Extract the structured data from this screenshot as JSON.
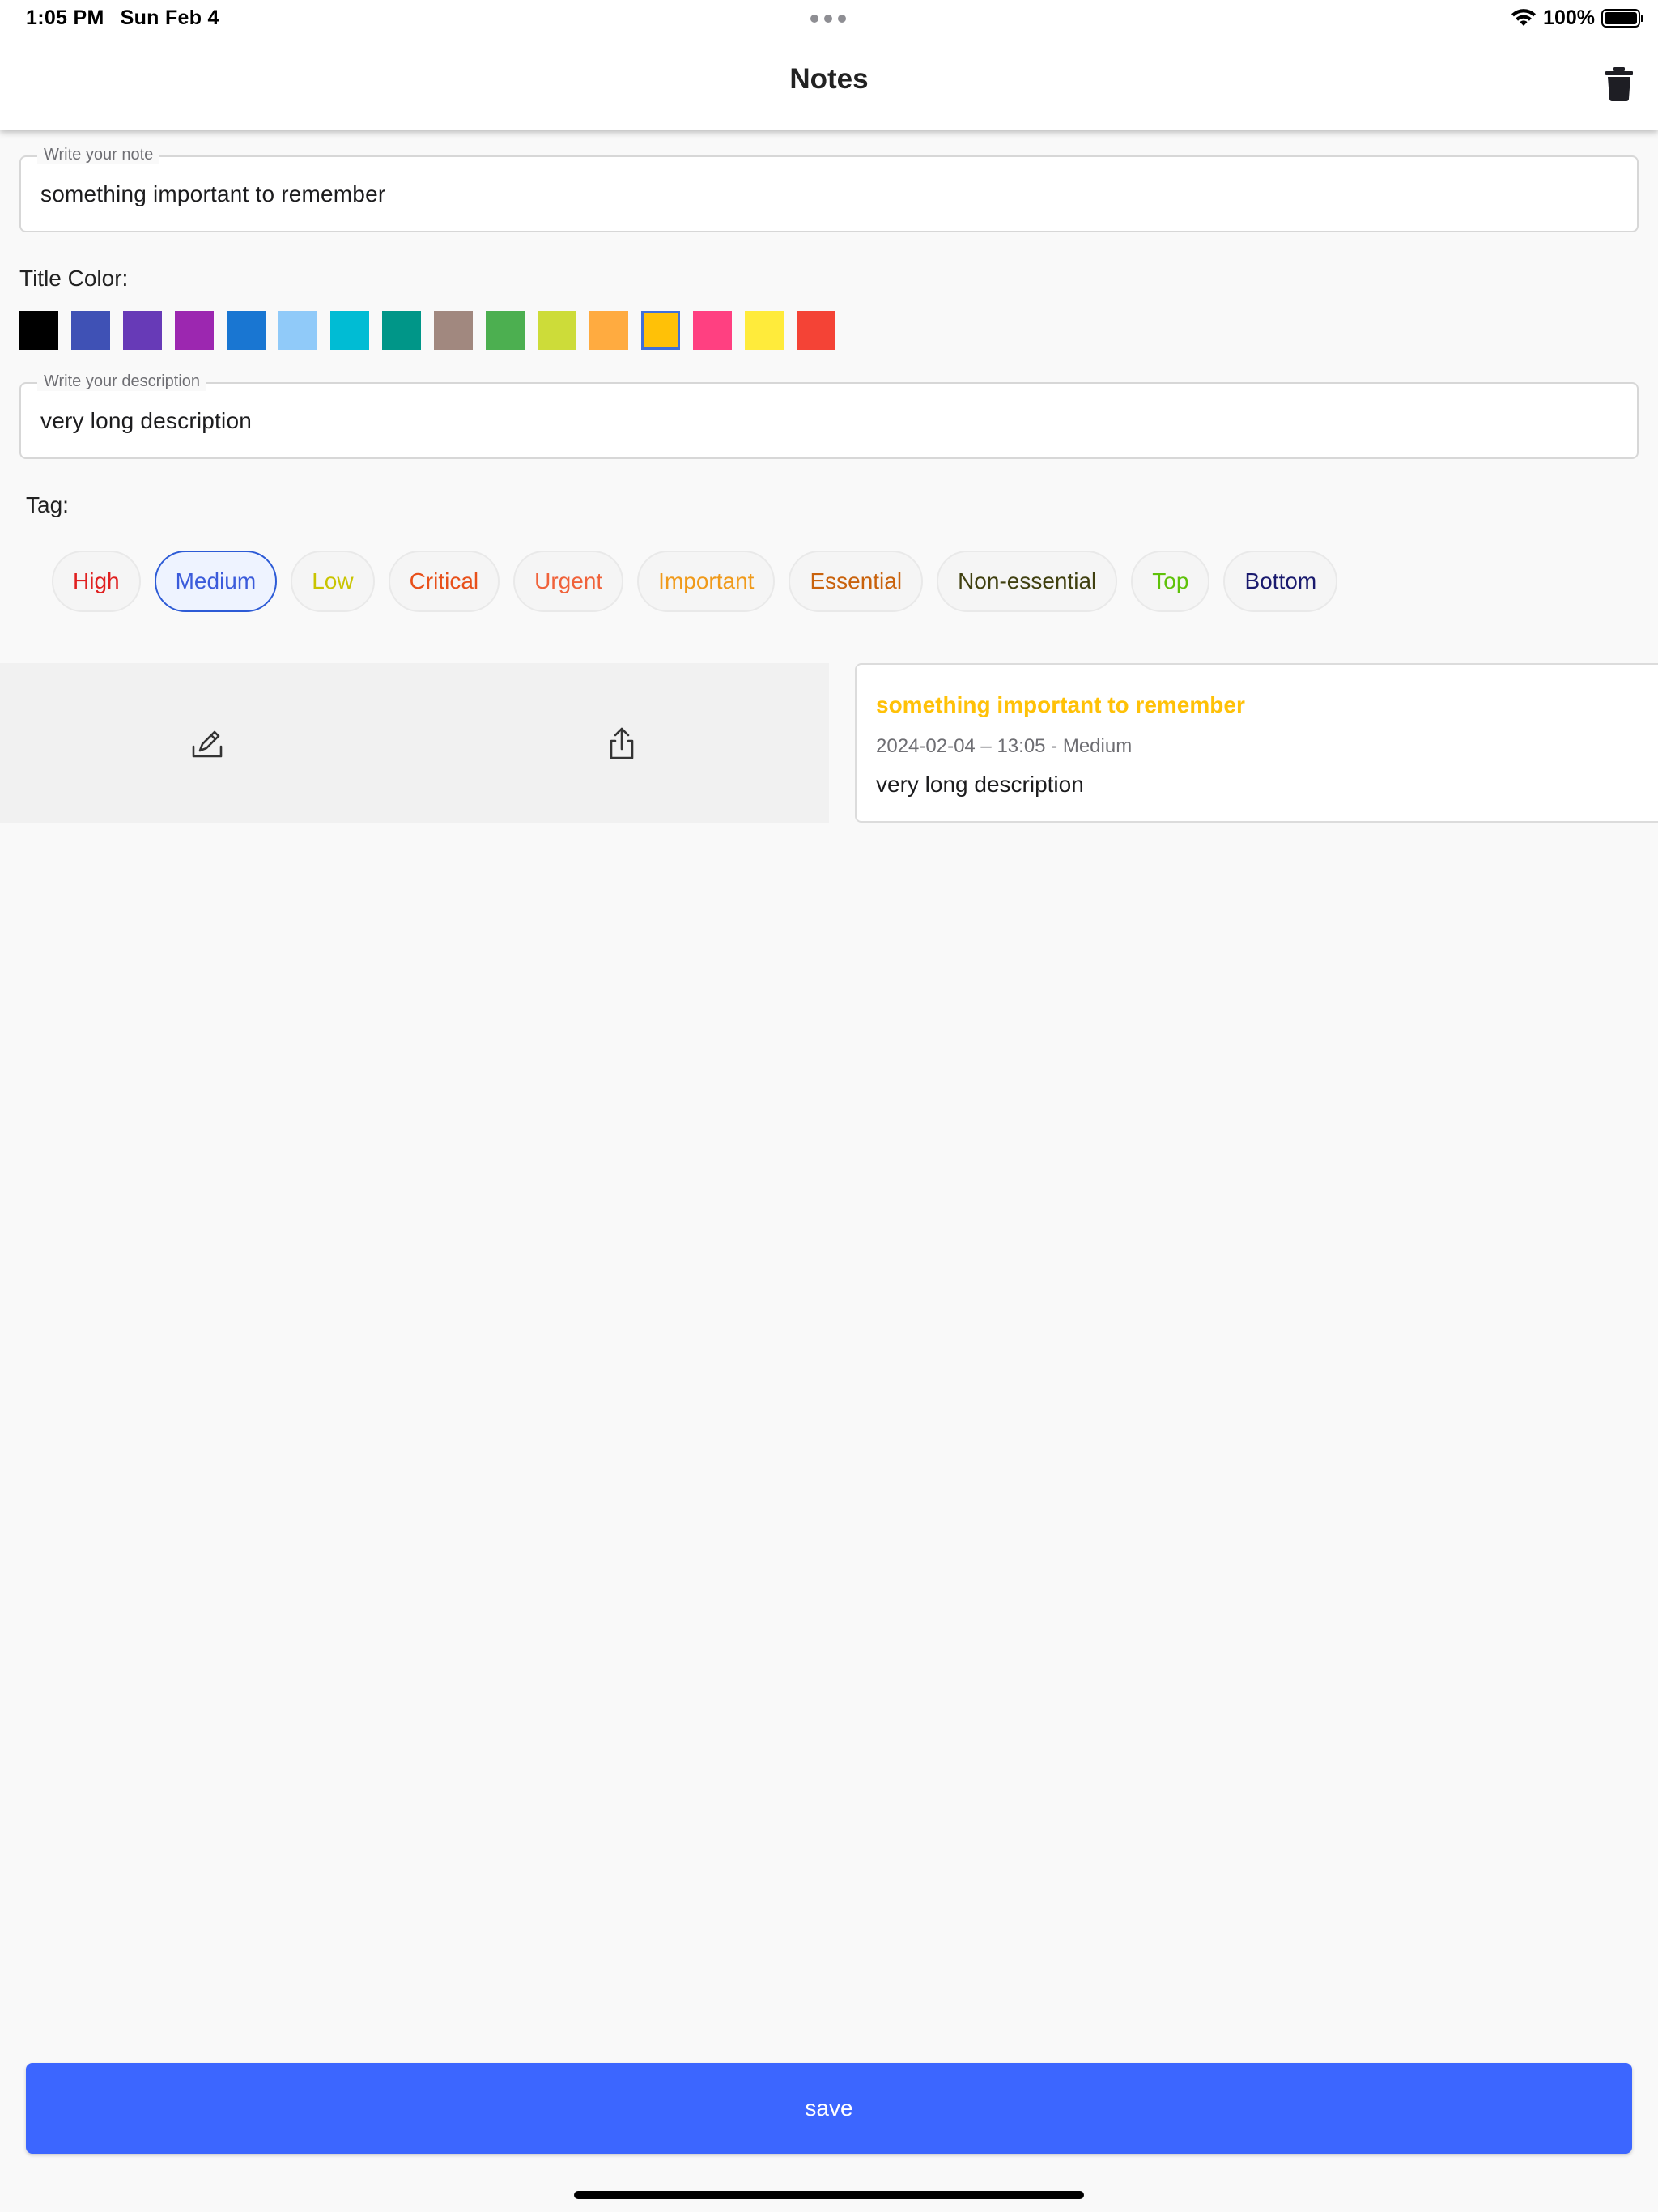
{
  "status_bar": {
    "time": "1:05 PM",
    "date": "Sun Feb 4",
    "battery": "100%"
  },
  "app_bar": {
    "title": "Notes",
    "delete_icon": "trash-icon"
  },
  "note_field": {
    "label": "Write your note",
    "value": "something important to remember"
  },
  "title_color": {
    "label": "Title Color:",
    "colors": [
      "#000000",
      "#3f51b5",
      "#673ab7",
      "#9c27b0",
      "#1976d2",
      "#90caf9",
      "#00bcd4",
      "#009688",
      "#a1887f",
      "#4caf50",
      "#cddc39",
      "#ffab40",
      "#ffc107",
      "#ff4081",
      "#ffeb3b",
      "#f44336"
    ],
    "selected": "#ffc107"
  },
  "description_field": {
    "label": "Write your description",
    "value": "very long description"
  },
  "tag": {
    "label": "Tag:",
    "options": [
      {
        "label": "High",
        "color": "#e02020"
      },
      {
        "label": "Medium",
        "color": "#3b5bdb"
      },
      {
        "label": "Low",
        "color": "#c9c400"
      },
      {
        "label": "Critical",
        "color": "#e8501a"
      },
      {
        "label": "Urgent",
        "color": "#f0623a"
      },
      {
        "label": "Important",
        "color": "#f09a1a"
      },
      {
        "label": "Essential",
        "color": "#c9620c"
      },
      {
        "label": "Non-essential",
        "color": "#404010"
      },
      {
        "label": "Top",
        "color": "#5fc20a"
      },
      {
        "label": "Bottom",
        "color": "#1a1a6e"
      }
    ],
    "selected": "Medium"
  },
  "notes": [
    {
      "title": "something important to remember",
      "title_color": "#ffc107",
      "meta": "2024-02-04 – 13:05 - Medium",
      "description": "very long description",
      "actions": [
        "edit-icon",
        "share-icon"
      ]
    }
  ],
  "save_label": "save"
}
